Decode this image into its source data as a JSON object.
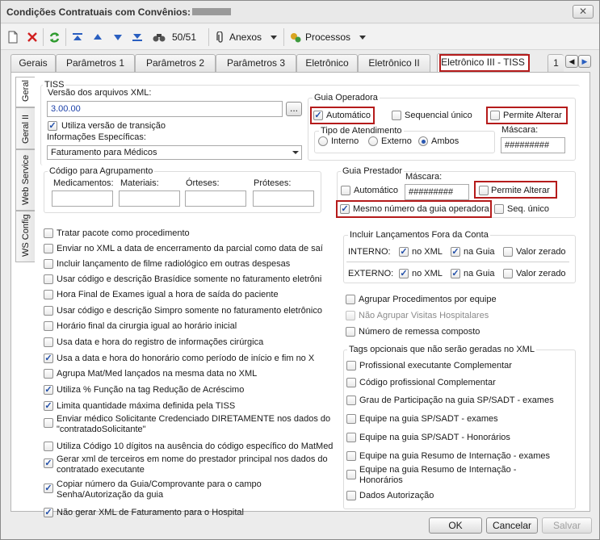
{
  "window": {
    "title": "Condições Contratuais com Convênios:",
    "close_label": "✕"
  },
  "toolbar": {
    "counter": "50/51",
    "annexes_label": "Anexos",
    "processes_label": "Processos"
  },
  "tabs": [
    "Gerais",
    "Parâmetros 1",
    "Parâmetros 2",
    "Parâmetros 3",
    "Eletrônico",
    "Eletrônico II",
    "Eletrônico III - TISS",
    "1"
  ],
  "side_tabs": [
    "Geral",
    "Geral II",
    "Web Service",
    "WS Config"
  ],
  "tiss": {
    "group_title": "TISS",
    "version_label": "Versão dos arquivos XML:",
    "version_value": "3.00.00",
    "browse_label": "...",
    "transition_label": "Utiliza versão de transição",
    "transition_checked": true,
    "specific_info_label": "Informações Específicas:",
    "specific_info_value": "Faturamento para Médicos"
  },
  "guia_operadora": {
    "title": "Guia Operadora",
    "automatic_label": "Automático",
    "automatic_checked": true,
    "sequential_label": "Sequencial único",
    "sequential_checked": false,
    "allow_change_label": "Permite Alterar",
    "allow_change_checked": false,
    "attendance_type_title": "Tipo de Atendimento",
    "attendance_options": [
      "Interno",
      "Externo",
      "Ambos"
    ],
    "attendance_selected": "Ambos",
    "mask_label": "Máscara:",
    "mask_value": "#########"
  },
  "grouping": {
    "title": "Código para Agrupamento",
    "fields": [
      "Medicamentos:",
      "Materiais:",
      "Órteses:",
      "Próteses:"
    ]
  },
  "guia_prestador": {
    "title": "Guia Prestador",
    "automatic_label": "Automático",
    "automatic_checked": false,
    "mask_label": "Máscara:",
    "mask_value": "#########",
    "allow_change_label": "Permite Alterar",
    "allow_change_checked": false,
    "same_number_label": "Mesmo número da guia operadora",
    "same_number_checked": true,
    "seq_label": "Seq. único",
    "seq_checked": false
  },
  "left_options": [
    {
      "label": "Tratar pacote como procedimento",
      "checked": false
    },
    {
      "label": "Enviar no XML a data de encerramento da parcial como data de saí",
      "checked": false
    },
    {
      "label": "Incluir lançamento de filme radiológico em outras despesas",
      "checked": false
    },
    {
      "label": "Usar código e descrição Brasídice somente no faturamento eletrôni",
      "checked": false
    },
    {
      "label": "Hora Final de Exames igual a hora de saída do paciente",
      "checked": false
    },
    {
      "label": "Usar código e descrição Simpro somente no faturamento eletrônico",
      "checked": false
    },
    {
      "label": "Horário final da cirurgia igual ao horário inicial",
      "checked": false
    },
    {
      "label": "Usa data e hora do registro de informações cirúrgica",
      "checked": false
    },
    {
      "label": "Usa a data e hora do honorário como período de início e fim no X",
      "checked": true
    },
    {
      "label": "Agrupa Mat/Med lançados na mesma data no XML",
      "checked": false
    },
    {
      "label": "Utiliza % Função na tag Redução de Acréscimo",
      "checked": true
    },
    {
      "label": "Limita quantidade máxima definida pela TISS",
      "checked": true
    },
    {
      "label": "Enviar médico Solicitante Credenciado DIRETAMENTE nos dados do \"contratadoSolicitante\"",
      "checked": false
    },
    {
      "label": "Utiliza Código 10 dígitos na ausência do código específico do MatMed",
      "checked": false
    },
    {
      "label": "Gerar xml de terceiros em nome do prestador principal nos dados do contratado executante",
      "checked": true
    },
    {
      "label": "Copiar número da Guia/Comprovante para o campo Senha/Autorização da guia",
      "checked": true
    },
    {
      "label": "Não gerar XML de Faturamento para o Hospital",
      "checked": true
    }
  ],
  "external_launches": {
    "title": "Incluir Lançamentos Fora da Conta",
    "rows": [
      {
        "label": "INTERNO:",
        "no_xml": "no XML",
        "no_xml_checked": true,
        "na_guia": "na Guia",
        "na_guia_checked": true,
        "valor_zerado": "Valor zerado",
        "valor_zerado_checked": false
      },
      {
        "label": "EXTERNO:",
        "no_xml": "no XML",
        "no_xml_checked": true,
        "na_guia": "na Guia",
        "na_guia_checked": true,
        "valor_zerado": "Valor zerado",
        "valor_zerado_checked": false
      }
    ]
  },
  "right_options": [
    {
      "label": "Agrupar Procedimentos por equipe",
      "checked": false,
      "disabled": false
    },
    {
      "label": "Não Agrupar Visitas Hospitalares",
      "checked": false,
      "disabled": true
    },
    {
      "label": "Número de remessa composto",
      "checked": false,
      "disabled": false
    }
  ],
  "optional_tags": {
    "title": "Tags opcionais que não serão geradas no XML",
    "items": [
      {
        "label": "Profissional executante Complementar",
        "checked": false
      },
      {
        "label": "Código profissional Complementar",
        "checked": false
      },
      {
        "label": "Grau de Participação na guia SP/SADT - exames",
        "checked": false
      },
      {
        "label": "Equipe na guia SP/SADT - exames",
        "checked": false
      },
      {
        "label": "Equipe na guia SP/SADT - Honorários",
        "checked": false
      },
      {
        "label": "Equipe na guia Resumo de Internação - exames",
        "checked": false
      },
      {
        "label": "Equipe na guia Resumo de Internação - Honorários",
        "checked": false
      },
      {
        "label": "Dados Autorização",
        "checked": false
      }
    ]
  },
  "footer": {
    "ok": "OK",
    "cancel": "Cancelar",
    "save": "Salvar"
  },
  "colors": {
    "highlight": "#b51b1b",
    "check": "#1f4da8",
    "link_value": "#1a3fa8"
  }
}
